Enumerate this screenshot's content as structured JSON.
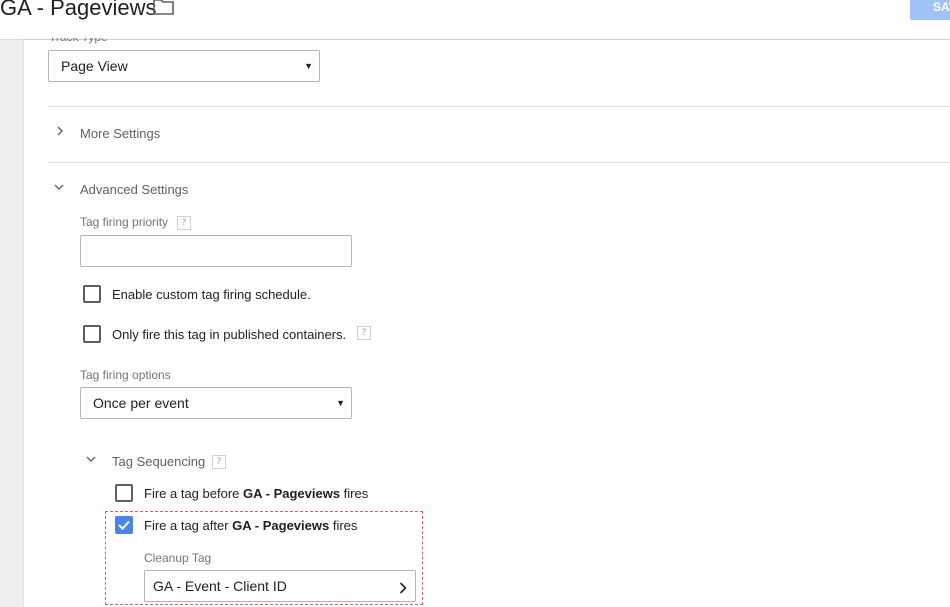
{
  "header": {
    "title": "GA - Pageviews",
    "save_label": "SAVE"
  },
  "track_type": {
    "label": "Track Type",
    "value": "Page View"
  },
  "more_settings": {
    "label": "More Settings"
  },
  "advanced_settings": {
    "label": "Advanced Settings",
    "priority_label": "Tag firing priority",
    "priority_value": "",
    "custom_schedule_label": "Enable custom tag firing schedule.",
    "published_only_label": "Only fire this tag in published containers.",
    "firing_options_label": "Tag firing options",
    "firing_options_value": "Once per event"
  },
  "tag_sequencing": {
    "label": "Tag Sequencing",
    "before": {
      "prefix": "Fire a tag before ",
      "tag": "GA - Pageviews",
      "suffix": " fires",
      "checked": false
    },
    "after": {
      "prefix": "Fire a tag after ",
      "tag": "GA - Pageviews",
      "suffix": " fires",
      "checked": true
    },
    "cleanup_label": "Cleanup Tag",
    "cleanup_value": "GA - Event - Client ID"
  },
  "help_glyph": "?",
  "colors": {
    "accent": "#4a86e8",
    "save_button": "#a0c3f6",
    "highlight": "#e06060"
  }
}
